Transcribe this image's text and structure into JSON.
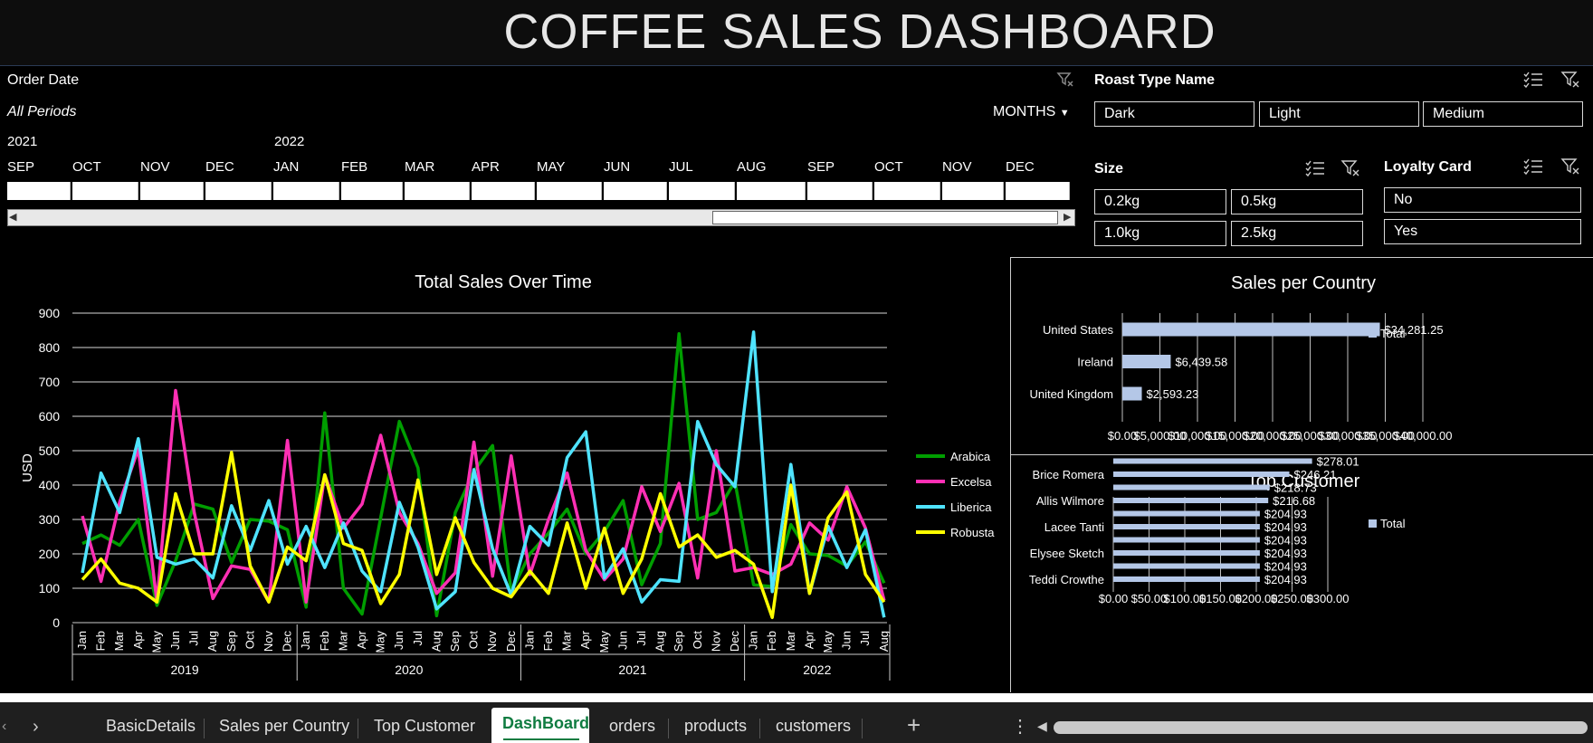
{
  "title": "COFFEE SALES DASHBOARD",
  "timeline": {
    "header": "Order Date",
    "period_label": "All Periods",
    "level": "MONTHS",
    "years": [
      "2021",
      "2022"
    ],
    "months": [
      "SEP",
      "OCT",
      "NOV",
      "DEC",
      "JAN",
      "FEB",
      "MAR",
      "APR",
      "MAY",
      "JUN",
      "JUL",
      "AUG",
      "SEP",
      "OCT",
      "NOV",
      "DEC"
    ]
  },
  "roast_slicer": {
    "header": "Roast Type Name",
    "items": [
      "Dark",
      "Light",
      "Medium"
    ]
  },
  "size_slicer": {
    "header": "Size",
    "items": [
      "0.2kg",
      "0.5kg",
      "1.0kg",
      "2.5kg"
    ]
  },
  "loyalty_slicer": {
    "header": "Loyalty Card",
    "items": [
      "No",
      "Yes"
    ]
  },
  "colors": {
    "arabica": "#009e00",
    "excelsa": "#ff2fb4",
    "liberica": "#4fe3ff",
    "robusta": "#ffff00",
    "bar": "#b4c7e7"
  },
  "chart_data": [
    {
      "type": "line",
      "title": "Total Sales Over Time",
      "ylabel": "USD",
      "ylim": [
        0,
        900
      ],
      "yticks": [
        0,
        100,
        200,
        300,
        400,
        500,
        600,
        700,
        800,
        900
      ],
      "grid": true,
      "legend": "right",
      "months": [
        "Jan",
        "Feb",
        "Mar",
        "Apr",
        "May",
        "Jun",
        "Jul",
        "Aug",
        "Sep",
        "Oct",
        "Nov",
        "Dec"
      ],
      "years": [
        "2019",
        "2020",
        "2021",
        "2022"
      ],
      "x_count": 44,
      "series": [
        {
          "name": "Arabica",
          "color": "#009e00",
          "values": [
            230,
            255,
            225,
            300,
            50,
            180,
            345,
            330,
            175,
            300,
            295,
            270,
            45,
            610,
            100,
            25,
            305,
            585,
            450,
            20,
            320,
            440,
            515,
            90,
            200,
            260,
            330,
            200,
            265,
            355,
            110,
            230,
            840,
            300,
            320,
            410,
            110,
            105,
            285,
            200,
            195,
            165,
            235,
            115
          ]
        },
        {
          "name": "Excelsa",
          "color": "#ff2fb4",
          "values": [
            310,
            120,
            350,
            505,
            60,
            675,
            320,
            70,
            165,
            155,
            60,
            530,
            60,
            430,
            275,
            345,
            545,
            320,
            230,
            85,
            145,
            525,
            135,
            485,
            140,
            300,
            435,
            210,
            125,
            185,
            395,
            265,
            405,
            130,
            500,
            150,
            160,
            140,
            170,
            290,
            240,
            395,
            275,
            65
          ]
        },
        {
          "name": "Liberica",
          "color": "#4fe3ff",
          "values": [
            145,
            435,
            320,
            535,
            190,
            170,
            185,
            130,
            340,
            210,
            355,
            170,
            280,
            160,
            290,
            150,
            90,
            350,
            220,
            40,
            90,
            445,
            215,
            80,
            280,
            225,
            480,
            555,
            130,
            215,
            60,
            125,
            120,
            585,
            460,
            395,
            845,
            90,
            460,
            85,
            280,
            160,
            270,
            15
          ]
        },
        {
          "name": "Robusta",
          "color": "#ffff00",
          "values": [
            125,
            185,
            115,
            100,
            60,
            375,
            200,
            200,
            495,
            165,
            60,
            220,
            180,
            430,
            230,
            210,
            55,
            140,
            415,
            140,
            305,
            175,
            100,
            75,
            150,
            85,
            290,
            100,
            275,
            85,
            185,
            375,
            220,
            255,
            190,
            210,
            170,
            15,
            400,
            85,
            305,
            380,
            140,
            60
          ]
        }
      ]
    },
    {
      "type": "bar",
      "title": "Sales per Country",
      "categories": [
        "United States",
        "Ireland",
        "United Kingdom"
      ],
      "values": [
        34281.25,
        6439.58,
        2593.23
      ],
      "labels": [
        "$34,281.25",
        "$6,439.58",
        "$2,593.23"
      ],
      "xlim": [
        0,
        40000
      ],
      "xticks": [
        "$0.00",
        "$5,000.00",
        "$10,000.00",
        "$15,000.00",
        "$20,000.00",
        "$25,000.00",
        "$30,000.00",
        "$35,000.00",
        "$40,000.00"
      ],
      "legend": "Total"
    },
    {
      "type": "bar",
      "title": "Top Customer",
      "categories": [
        "",
        "Brice Romera",
        "",
        "Allis Wilmore",
        "",
        "Lacee Tanti",
        "",
        "Elysee Sketch",
        "",
        "Teddi Crowthe"
      ],
      "values": [
        278.01,
        246.21,
        218.73,
        216.68,
        204.93,
        204.93,
        204.93,
        204.93,
        204.93,
        204.93
      ],
      "labels": [
        "$278.01",
        "$246.21",
        "$218.73",
        "$216.68",
        "$204.93",
        "$204.93",
        "$204.93",
        "$204.93",
        "$204.93",
        "$204.93"
      ],
      "xlim": [
        0,
        300
      ],
      "xticks": [
        "$0.00",
        "$50.00",
        "$100.00",
        "$150.00",
        "$200.00",
        "$250.00",
        "$300.00"
      ],
      "legend": "Total"
    }
  ],
  "tabs": [
    "BasicDetails",
    "Sales per Country",
    "Top Customer",
    "DashBoard",
    "orders",
    "products",
    "customers"
  ],
  "active_tab": "DashBoard",
  "add_sheet": "+"
}
